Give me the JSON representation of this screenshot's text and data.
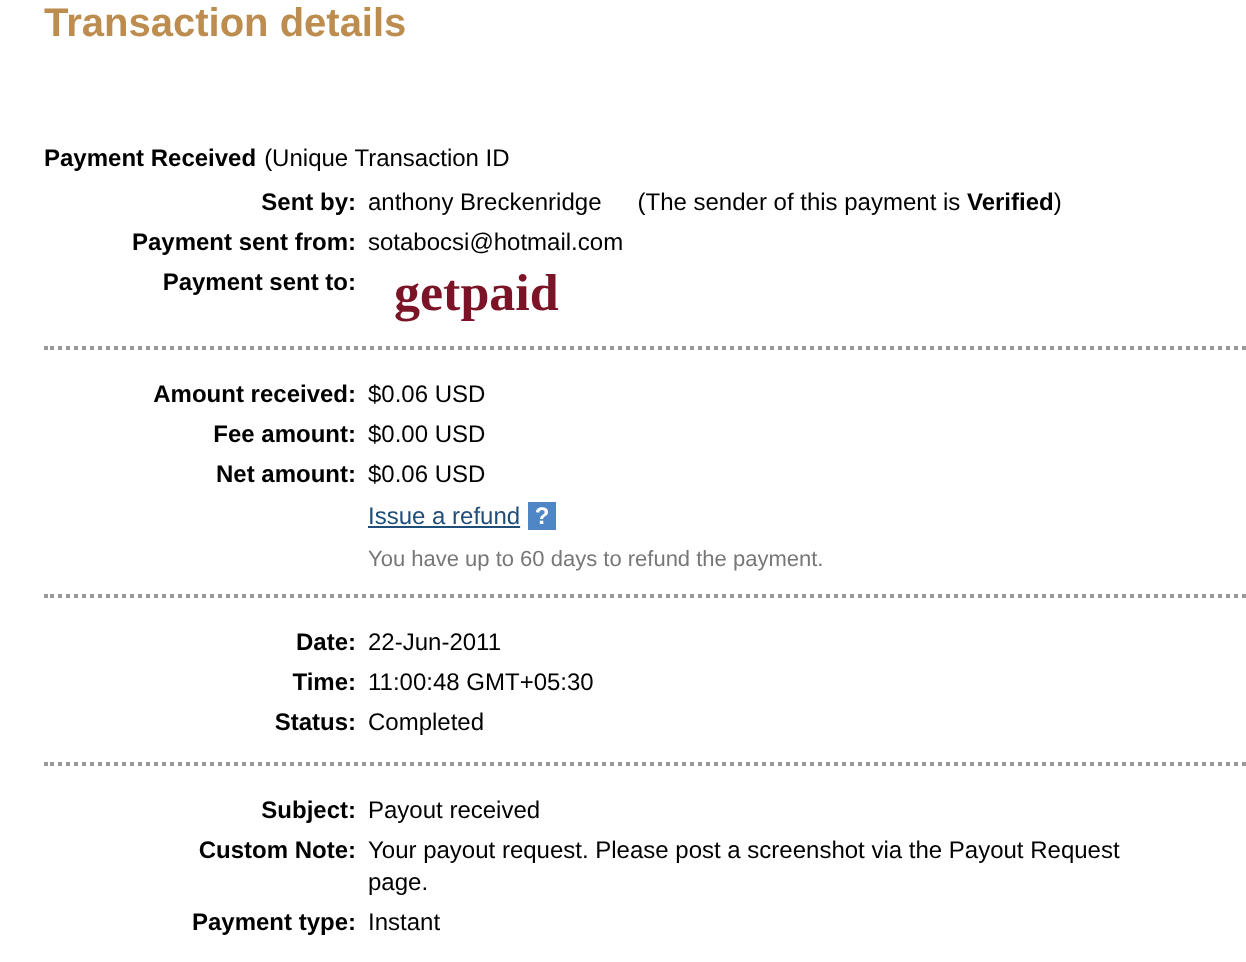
{
  "title": "Transaction details",
  "heading": {
    "label": "Payment Received",
    "note": "(Unique Transaction ID"
  },
  "sections": [
    {
      "rows": [
        {
          "kind": "text",
          "label": "Sent by:",
          "value": "anthony Breckenridge",
          "note": "(The sender of this payment is **Verified**)"
        },
        {
          "kind": "text",
          "label": "Payment sent from:",
          "value": "sotabocsi@hotmail.com"
        },
        {
          "kind": "recipient",
          "label": "Payment sent to:",
          "value": "getpaid"
        }
      ]
    },
    {
      "rows": [
        {
          "kind": "text",
          "label": "Amount received:",
          "value": "$0.06 USD"
        },
        {
          "kind": "text",
          "label": "Fee amount:",
          "value": "$0.00 USD"
        },
        {
          "kind": "text",
          "label": "Net amount:",
          "value": "$0.06 USD"
        }
      ],
      "refund": {
        "link": "Issue a refund",
        "help": "?",
        "hint": "You have up to 60 days to refund the payment."
      }
    },
    {
      "rows": [
        {
          "kind": "text",
          "label": "Date:",
          "value": "22-Jun-2011"
        },
        {
          "kind": "text",
          "label": "Time:",
          "value": "11:00:48 GMT+05:30"
        },
        {
          "kind": "text",
          "label": "Status:",
          "value": "Completed"
        }
      ]
    },
    {
      "rows": [
        {
          "kind": "text",
          "label": "Subject:",
          "value": "Payout received"
        },
        {
          "kind": "text",
          "label": "Custom Note:",
          "value": "Your payout request. Please post a screenshot via the Payout Request page."
        },
        {
          "kind": "text",
          "label": "Payment type:",
          "value": "Instant"
        }
      ]
    }
  ]
}
